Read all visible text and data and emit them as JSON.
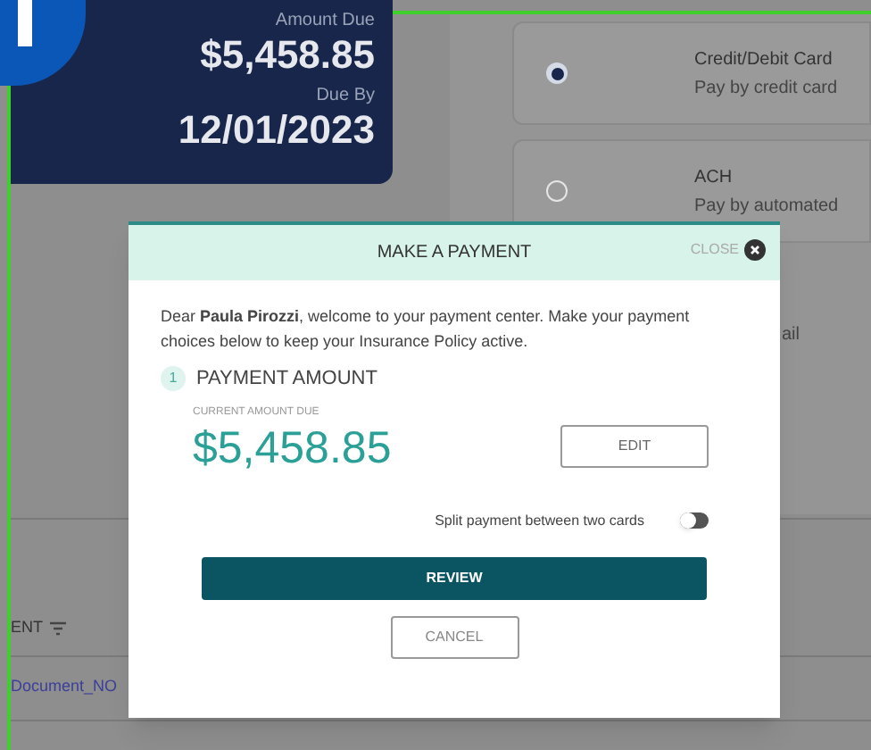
{
  "summary_card": {
    "amount_label": "Amount Due",
    "amount": "$5,458.85",
    "due_label": "Due By",
    "due_date": "12/01/2023"
  },
  "payment_methods": [
    {
      "title": "Credit/Debit Card",
      "description": "Pay by credit card",
      "selected": true
    },
    {
      "title": "ACH",
      "description": "Pay by automated",
      "selected": false
    }
  ],
  "side_fragment": "ail",
  "table": {
    "column_header": "ENT",
    "rows": [
      {
        "link": "Document_NO"
      }
    ]
  },
  "modal": {
    "title": "MAKE A PAYMENT",
    "close_label": "CLOSE",
    "greeting": "Dear **Paula Pirozzi**, welcome to your payment center. Make your payment choices below to keep your Insurance Policy active.",
    "step_number": "1",
    "step_title": "PAYMENT AMOUNT",
    "amount_label": "CURRENT AMOUNT DUE",
    "amount": "$5,458.85",
    "edit_label": "EDIT",
    "split": {
      "label": "Split payment between two cards",
      "on": false
    },
    "review_label": "REVIEW",
    "cancel_label": "CANCEL"
  }
}
